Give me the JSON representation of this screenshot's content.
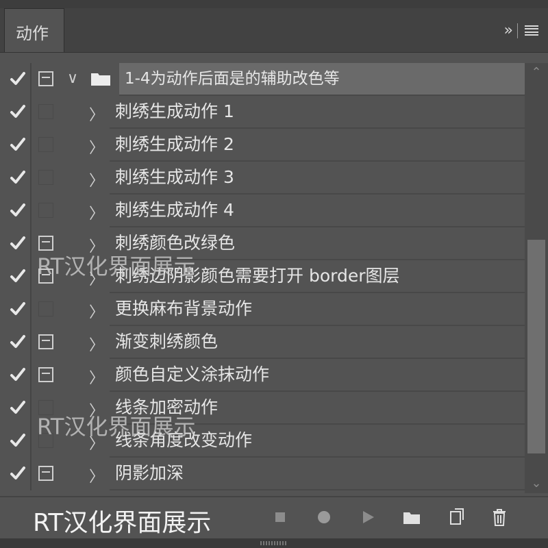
{
  "tab": {
    "title": "动作"
  },
  "header_icons": {
    "expand": "»",
    "menu": "menu-icon"
  },
  "actions": [
    {
      "label": "1-4为动作后面是的辅助改色等",
      "type": "set",
      "dialog": true,
      "expanded": true
    },
    {
      "label": "刺绣生成动作 1",
      "type": "action",
      "dialog": false
    },
    {
      "label": "刺绣生成动作 2",
      "type": "action",
      "dialog": false
    },
    {
      "label": "刺绣生成动作 3",
      "type": "action",
      "dialog": false
    },
    {
      "label": "刺绣生成动作 4",
      "type": "action",
      "dialog": false
    },
    {
      "label": "刺绣颜色改绿色",
      "type": "action",
      "dialog": true
    },
    {
      "label": "刺绣边阴影颜色需要打开 border图层",
      "type": "action",
      "dialog": true
    },
    {
      "label": "更换麻布背景动作",
      "type": "action",
      "dialog": false
    },
    {
      "label": "渐变刺绣颜色",
      "type": "action",
      "dialog": true
    },
    {
      "label": "颜色自定义涂抹动作",
      "type": "action",
      "dialog": true
    },
    {
      "label": "线条加密动作",
      "type": "action",
      "dialog": false
    },
    {
      "label": "线条角度改变动作",
      "type": "action",
      "dialog": false
    },
    {
      "label": "阴影加深",
      "type": "action",
      "dialog": true
    }
  ],
  "watermark": {
    "text": "RT汉化界面展示"
  },
  "bottom": {
    "text": "RT汉化界面展示",
    "tools": [
      "stop-icon",
      "record-icon",
      "play-icon",
      "folder-icon",
      "new-action-icon",
      "trash-icon"
    ]
  },
  "colors": {
    "panel": "#535353",
    "selected": "#6a6a6a",
    "text": "#e6e6e6"
  }
}
